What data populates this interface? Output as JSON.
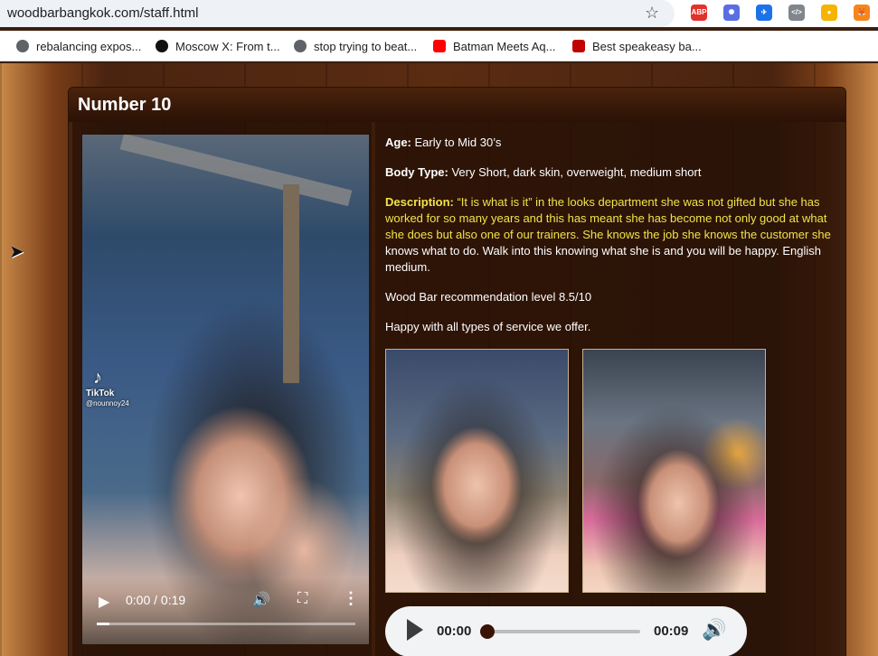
{
  "browser": {
    "url": "woodbarbangkok.com/staff.html",
    "bookmark_star": "☆",
    "extensions": [
      {
        "name": "adblock-icon",
        "label": "ABP",
        "color": "#e2322b"
      },
      {
        "name": "extension-sparkle-icon",
        "label": "✺",
        "color": "#5b6ee1"
      },
      {
        "name": "extension-bird-icon",
        "label": "✈",
        "color": "#1a73e8"
      },
      {
        "name": "extension-code-icon",
        "label": "</>",
        "color": "#80868b"
      },
      {
        "name": "extension-color-icon",
        "label": "●",
        "color": "#f4b400"
      },
      {
        "name": "metamask-icon",
        "label": "🦊",
        "color": "#f6851b"
      }
    ],
    "bookmarks": [
      {
        "label": "rebalancing expos...",
        "icon": "globe-icon",
        "color": "#5f6368"
      },
      {
        "label": "Moscow X: From t...",
        "icon": "amazon-icon",
        "color": "#111111"
      },
      {
        "label": "stop trying to beat...",
        "icon": "globe-icon",
        "color": "#5f6368"
      },
      {
        "label": "Batman Meets Aq...",
        "icon": "youtube-icon",
        "color": "#ff0000"
      },
      {
        "label": "Best speakeasy ba...",
        "icon": "flag-icon",
        "color": "#c00000"
      }
    ]
  },
  "profile": {
    "title": "Number 10",
    "age_label": "Age:",
    "age_value": " Early to Mid 30’s",
    "body_label": "Body Type:",
    "body_value": " Very Short, dark skin, overweight, medium short",
    "desc_label": "Description:",
    "desc_yellow": " “It is what is it” in the looks department she was not gifted but she has worked for so many years and this has meant she has become not only good at what she does but also one of our trainers. She knows the job she knows the customer she",
    "desc_white": " knows what to do. Walk into this knowing what she is and you will be happy. English medium.",
    "recommendation": "Wood Bar recommendation level 8.5/10",
    "service": "Happy with all types of service we offer."
  },
  "video": {
    "time": "0:00 / 0:19",
    "tiktok_label": "TikTok",
    "tiktok_user": "@nounnoy24",
    "progress": 0.05
  },
  "audio": {
    "current": "00:00",
    "duration": "00:09",
    "progress": 0
  }
}
